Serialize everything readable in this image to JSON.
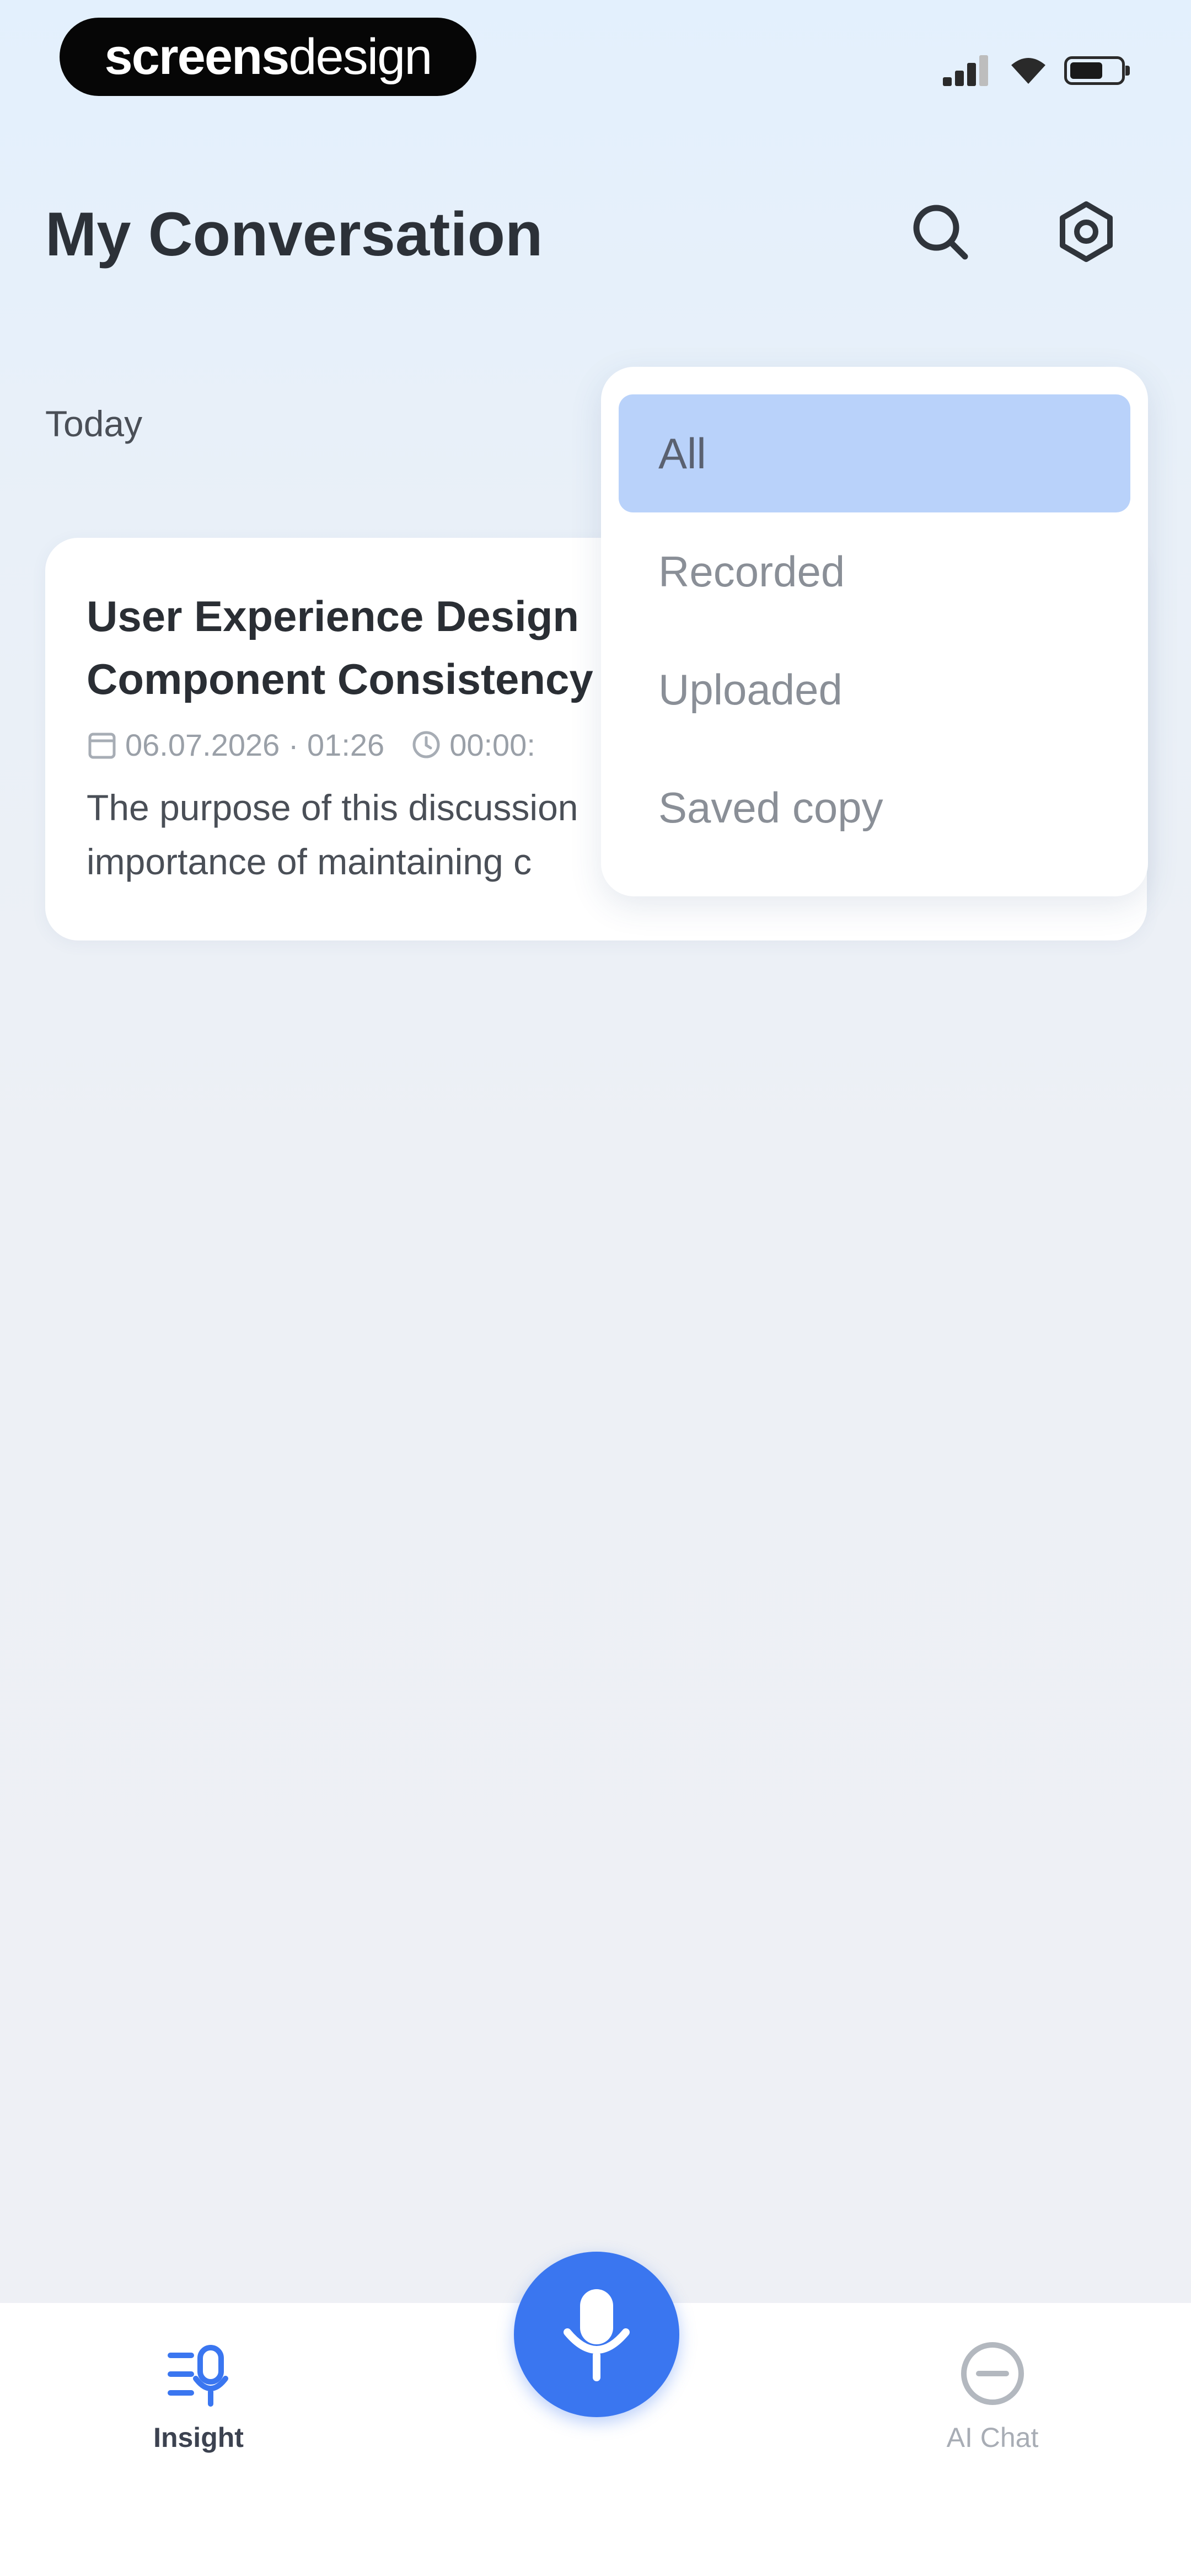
{
  "status_bar": {
    "brand_part1": "screens",
    "brand_part2": "design"
  },
  "header": {
    "title": "My Conversation",
    "search_icon": "search-icon",
    "settings_icon": "gear-icon"
  },
  "section": {
    "label": "Today"
  },
  "card": {
    "title_line1": "User Experience Design",
    "title_line2": "Component Consistency",
    "date": "06.07.2026 · 01:26",
    "duration": "00:00:",
    "desc_line1": "The purpose of this discussion",
    "desc_line2": "importance of maintaining c"
  },
  "filter_menu": {
    "selected": "All",
    "items": [
      {
        "label": "All"
      },
      {
        "label": "Recorded"
      },
      {
        "label": "Uploaded"
      },
      {
        "label": "Saved copy"
      }
    ]
  },
  "tab_bar": {
    "insight_label": "Insight",
    "chat_label": "AI Chat",
    "mic_icon": "microphone-icon"
  },
  "colors": {
    "accent": "#3a76f0",
    "selected_bg": "#b9d2fa",
    "title_text": "#2c3138"
  }
}
